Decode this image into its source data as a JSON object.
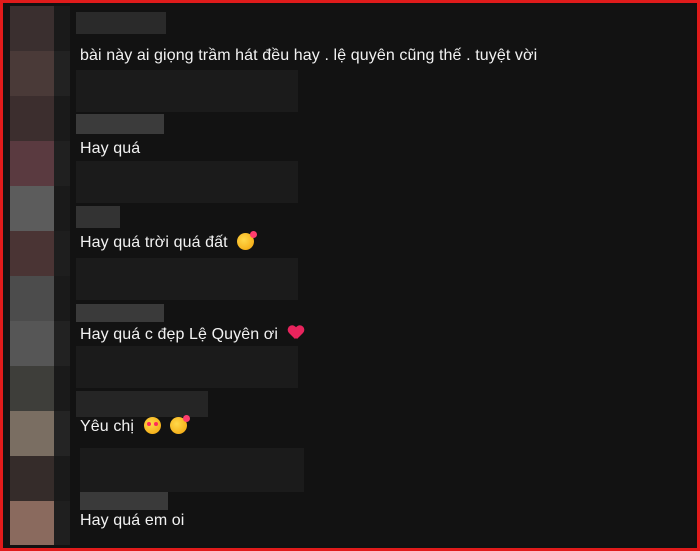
{
  "comments": [
    {
      "text": "bài này ai giọng trầm hát đều hay . lệ quyên cũng thế . tuyệt vời",
      "emoji": []
    },
    {
      "text": "Hay quá",
      "emoji": []
    },
    {
      "text": "Hay quá trời quá đất",
      "emoji": [
        "smiling-face-with-hearts"
      ]
    },
    {
      "text": "Hay quá c đẹp Lệ Quyên ơi",
      "emoji": [
        "heart"
      ]
    },
    {
      "text": "Yêu chị",
      "emoji": [
        "heart-eyes",
        "smiling-face-with-hearts"
      ]
    },
    {
      "text": "Hay quá em oi",
      "emoji": []
    }
  ],
  "colors": {
    "border": "#e01b1b",
    "background": "#121212",
    "text": "#f2f2f2"
  }
}
